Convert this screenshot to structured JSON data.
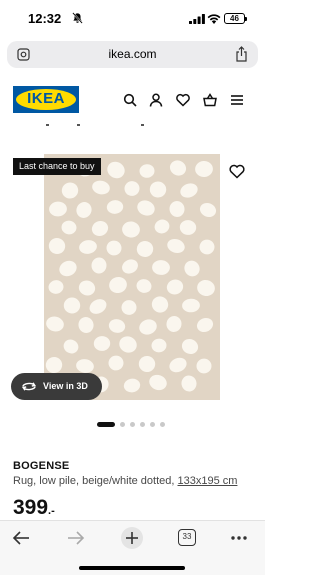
{
  "status_bar": {
    "time": "12:32",
    "battery": "46"
  },
  "browser": {
    "url": "ikea.com",
    "tabs_count": "33"
  },
  "header": {
    "logo_text": "IKEA"
  },
  "product": {
    "badge": "Last chance to buy",
    "view_3d_label": "View in 3D",
    "name": "BOGENSE",
    "description": "Rug, low pile, beige/white dotted,",
    "size": "133x195 cm",
    "price": "399",
    "price_suffix": ".-",
    "image_count": 6,
    "active_image": 1
  },
  "colors": {
    "brand_blue": "#0058a3",
    "brand_yellow": "#ffdb00",
    "rug_beige": "#e1d5c5",
    "rug_dot": "#faf6ee"
  }
}
